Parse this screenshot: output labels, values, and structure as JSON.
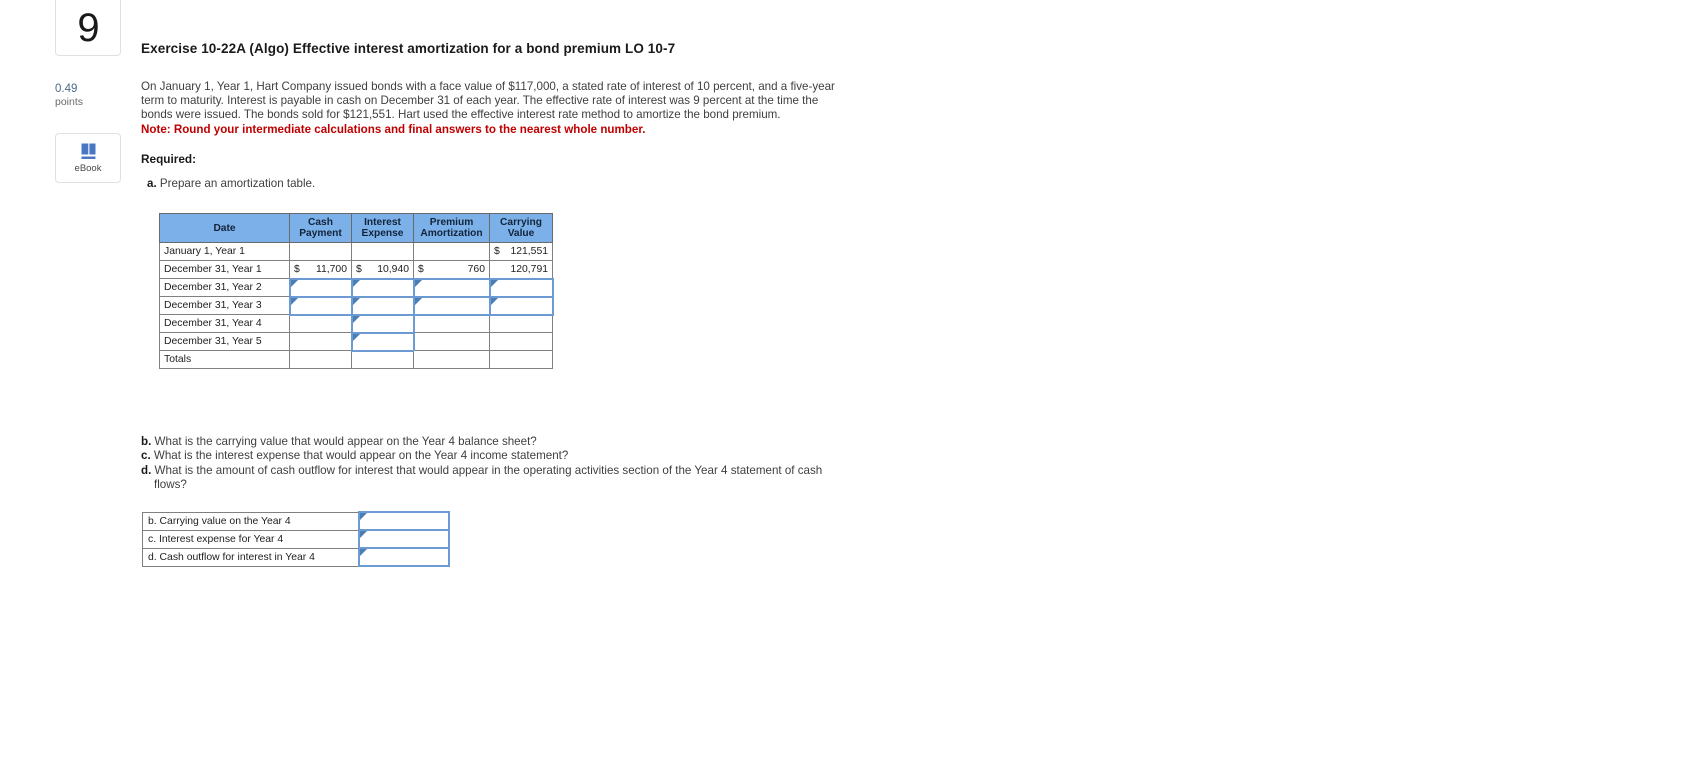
{
  "rail": {
    "question_number": "9",
    "points_value": "0.49",
    "points_label": "points",
    "ebook_label": "eBook"
  },
  "exercise": {
    "title": "Exercise 10-22A (Algo) Effective interest amortization for a bond premium LO 10-7",
    "body_line1": "On January 1, Year 1, Hart Company issued bonds with a face value of $117,000, a stated rate of interest of 10 percent, and a five-year",
    "body_line2": "term to maturity. Interest is payable in cash on December 31 of each year. The effective rate of interest was 9 percent at the time the",
    "body_line3": "bonds were issued. The bonds sold for $121,551. Hart used the effective interest rate method to amortize the bond premium.",
    "note": "Note: Round your intermediate calculations and final answers to the nearest whole number.",
    "required_label": "Required:",
    "req_a_marker": "a.",
    "req_a_text": "Prepare an amortization table."
  },
  "amortization_table": {
    "headers": [
      "Date",
      "Cash Payment",
      "Interest Expense",
      "Premium Amortization",
      "Carrying Value"
    ],
    "headers_split": [
      {
        "l1": "Date",
        "l2": ""
      },
      {
        "l1": "Cash",
        "l2": "Payment"
      },
      {
        "l1": "Interest",
        "l2": "Expense"
      },
      {
        "l1": "Premium",
        "l2": "Amortization"
      },
      {
        "l1": "Carrying",
        "l2": "Value"
      }
    ],
    "rows": [
      {
        "date": "January 1, Year 1",
        "cash_sym": "",
        "cash": "",
        "int_sym": "",
        "interest": "",
        "prem_sym": "",
        "premium": "",
        "carry_sym": "$",
        "carrying": "121,551"
      },
      {
        "date": "December 31, Year 1",
        "cash_sym": "$",
        "cash": "11,700",
        "int_sym": "$",
        "interest": "10,940",
        "prem_sym": "$",
        "premium": "760",
        "carry_sym": "",
        "carrying": "120,791"
      },
      {
        "date": "December 31, Year 2",
        "cash_sym": "",
        "cash": "",
        "int_sym": "",
        "interest": "",
        "prem_sym": "",
        "premium": "",
        "carry_sym": "",
        "carrying": ""
      },
      {
        "date": "December 31, Year 3",
        "cash_sym": "",
        "cash": "",
        "int_sym": "",
        "interest": "",
        "prem_sym": "",
        "premium": "",
        "carry_sym": "",
        "carrying": ""
      },
      {
        "date": "December 31, Year 4",
        "cash_sym": "",
        "cash": "",
        "int_sym": "",
        "interest": "",
        "prem_sym": "",
        "premium": "",
        "carry_sym": "",
        "carrying": ""
      },
      {
        "date": "December 31, Year 5",
        "cash_sym": "",
        "cash": "",
        "int_sym": "",
        "interest": "",
        "prem_sym": "",
        "premium": "",
        "carry_sym": "",
        "carrying": ""
      },
      {
        "date": "Totals",
        "cash_sym": "",
        "cash": "",
        "int_sym": "",
        "interest": "",
        "prem_sym": "",
        "premium": "",
        "carry_sym": "",
        "carrying": ""
      }
    ]
  },
  "questions": {
    "b_marker": "b.",
    "b_text": "What is the carrying value that would appear on the Year 4 balance sheet?",
    "c_marker": "c.",
    "c_text": "What is the interest expense that would appear on the Year 4 income statement?",
    "d_marker": "d.",
    "d_text": "What is the amount of cash outflow for interest that would appear in the operating activities section of the Year 4 statement of cash",
    "d_text2": "flows?"
  },
  "answer_table": {
    "rows": [
      {
        "label": "b. Carrying value on the Year 4",
        "value": ""
      },
      {
        "label": "c. Interest expense for Year 4",
        "value": ""
      },
      {
        "label": "d. Cash outflow for interest in Year 4",
        "value": ""
      }
    ]
  },
  "colors": {
    "header_blue": "#7cb0e8",
    "active_border": "#6b9bd2",
    "note_red": "#c00000",
    "points_blue": "#4b6a86"
  }
}
